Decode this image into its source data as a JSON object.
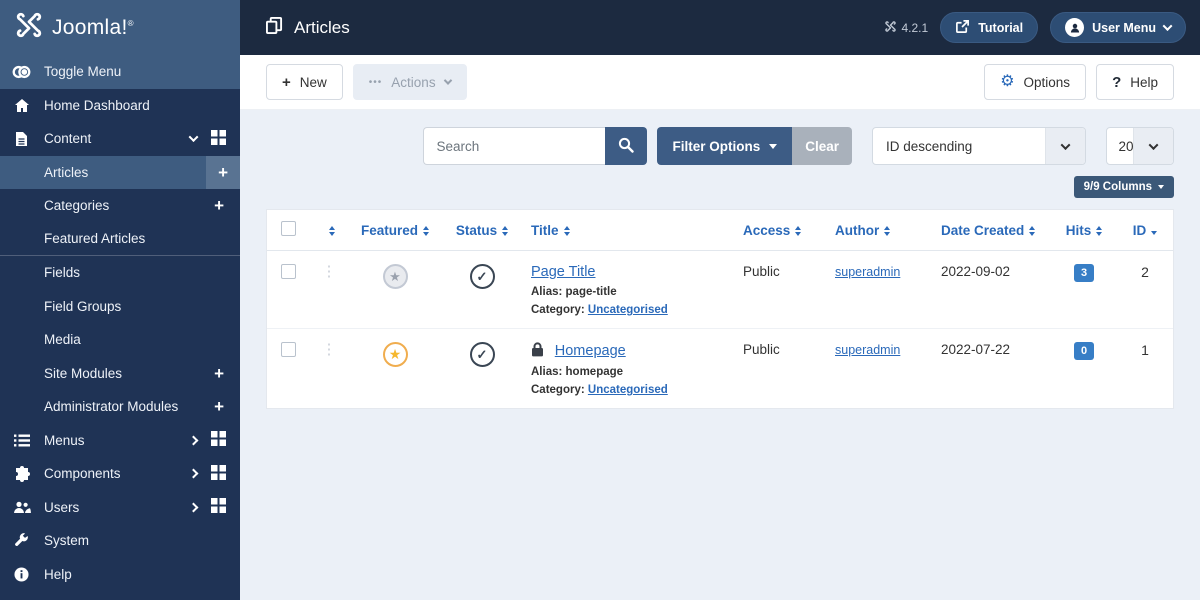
{
  "brand": {
    "name": "Joomla!",
    "reg": "®"
  },
  "header": {
    "title": "Articles",
    "version": "4.2.1",
    "tutorial": "Tutorial",
    "user_menu": "User Menu"
  },
  "sidebar": {
    "items": [
      {
        "label": "Toggle Menu"
      },
      {
        "label": "Home Dashboard"
      },
      {
        "label": "Content"
      },
      {
        "label": "Articles"
      },
      {
        "label": "Categories"
      },
      {
        "label": "Featured Articles"
      },
      {
        "label": "Fields"
      },
      {
        "label": "Field Groups"
      },
      {
        "label": "Media"
      },
      {
        "label": "Site Modules"
      },
      {
        "label": "Administrator Modules"
      },
      {
        "label": "Menus"
      },
      {
        "label": "Components"
      },
      {
        "label": "Users"
      },
      {
        "label": "System"
      },
      {
        "label": "Help"
      }
    ]
  },
  "toolbar": {
    "new": "New",
    "actions": "Actions",
    "options": "Options",
    "help": "Help"
  },
  "filterbar": {
    "search_placeholder": "Search",
    "filter_options": "Filter Options",
    "clear": "Clear",
    "sort_value": "ID descending",
    "limit_value": "20",
    "columns": "9/9 Columns"
  },
  "table": {
    "headers": {
      "featured": "Featured",
      "status": "Status",
      "title": "Title",
      "access": "Access",
      "author": "Author",
      "date_created": "Date Created",
      "hits": "Hits",
      "id": "ID"
    },
    "rows": [
      {
        "title": "Page Title",
        "alias_label": "Alias:",
        "alias": "page-title",
        "category_label": "Category:",
        "category": "Uncategorised",
        "access": "Public",
        "author": "superadmin",
        "date_created": "2022-09-02",
        "hits": "3",
        "id": "2"
      },
      {
        "title": "Homepage",
        "alias_label": "Alias:",
        "alias": "homepage",
        "category_label": "Category:",
        "category": "Uncategorised",
        "access": "Public",
        "author": "superadmin",
        "date_created": "2022-07-22",
        "hits": "0",
        "id": "1"
      }
    ]
  },
  "glyphs": {
    "plus": "+",
    "ellipsis": "•••",
    "drag": "⋮",
    "check": "✓",
    "star": "★",
    "gear": "⚙",
    "question": "?"
  },
  "colors": {
    "topbar_bg": "#1c2a40",
    "sidebar_bg": "#1f3355",
    "highlight_bg": "#3e5c80",
    "accent_link": "#2a69b9",
    "button_steel": "#3d5c85",
    "badge_blue": "#377ec6",
    "featured_amber": "#f0ad4e",
    "clear_gray": "#a9b1bb",
    "content_bg": "#ebf0f7"
  }
}
